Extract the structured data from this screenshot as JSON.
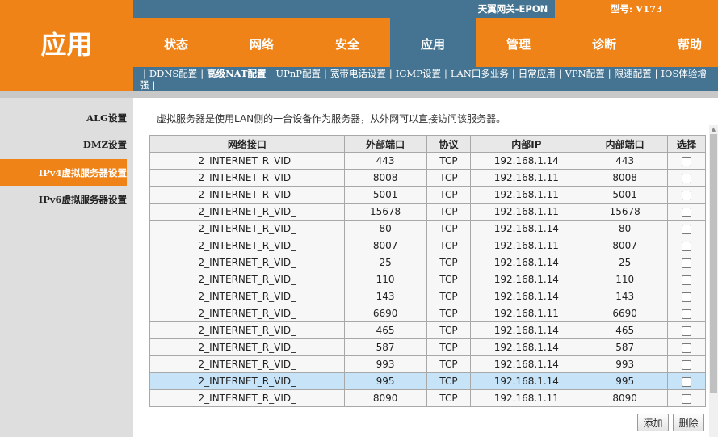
{
  "logo": {
    "text": "应用"
  },
  "header": {
    "gateway_name": "天翼网关-EPON",
    "model": "型号: V173"
  },
  "main_nav": [
    {
      "label": "状态",
      "active": false
    },
    {
      "label": "网络",
      "active": false
    },
    {
      "label": "安全",
      "active": false
    },
    {
      "label": "应用",
      "active": true
    },
    {
      "label": "管理",
      "active": false
    },
    {
      "label": "诊断",
      "active": false
    },
    {
      "label": "帮助",
      "active": false
    }
  ],
  "sub_nav": [
    {
      "label": "DDNS配置",
      "active": false
    },
    {
      "label": "高级NAT配置",
      "active": true
    },
    {
      "label": "UPnP配置",
      "active": false
    },
    {
      "label": "宽带电话设置",
      "active": false
    },
    {
      "label": "IGMP设置",
      "active": false
    },
    {
      "label": "LAN口多业务",
      "active": false
    },
    {
      "label": "日常应用",
      "active": false
    },
    {
      "label": "VPN配置",
      "active": false
    },
    {
      "label": "限速配置",
      "active": false
    },
    {
      "label": "IOS体验增强",
      "active": false
    }
  ],
  "left_menu": [
    {
      "label": "ALG设置",
      "active": false
    },
    {
      "label": "DMZ设置",
      "active": false
    },
    {
      "label": "IPv4虚拟服务器设置",
      "active": true
    },
    {
      "label": "IPv6虚拟服务器设置",
      "active": false
    }
  ],
  "description": "虚拟服务器是使用LAN侧的一台设备作为服务器，从外网可以直接访问该服务器。",
  "table": {
    "headers": [
      "网络接口",
      "外部端口",
      "协议",
      "内部IP",
      "内部端口",
      "选择"
    ],
    "rows": [
      [
        "2_INTERNET_R_VID_",
        "443",
        "TCP",
        "192.168.1.14",
        "443"
      ],
      [
        "2_INTERNET_R_VID_",
        "8008",
        "TCP",
        "192.168.1.11",
        "8008"
      ],
      [
        "2_INTERNET_R_VID_",
        "5001",
        "TCP",
        "192.168.1.11",
        "5001"
      ],
      [
        "2_INTERNET_R_VID_",
        "15678",
        "TCP",
        "192.168.1.11",
        "15678"
      ],
      [
        "2_INTERNET_R_VID_",
        "80",
        "TCP",
        "192.168.1.14",
        "80"
      ],
      [
        "2_INTERNET_R_VID_",
        "8007",
        "TCP",
        "192.168.1.11",
        "8007"
      ],
      [
        "2_INTERNET_R_VID_",
        "25",
        "TCP",
        "192.168.1.14",
        "25"
      ],
      [
        "2_INTERNET_R_VID_",
        "110",
        "TCP",
        "192.168.1.14",
        "110"
      ],
      [
        "2_INTERNET_R_VID_",
        "143",
        "TCP",
        "192.168.1.14",
        "143"
      ],
      [
        "2_INTERNET_R_VID_",
        "6690",
        "TCP",
        "192.168.1.11",
        "6690"
      ],
      [
        "2_INTERNET_R_VID_",
        "465",
        "TCP",
        "192.168.1.14",
        "465"
      ],
      [
        "2_INTERNET_R_VID_",
        "587",
        "TCP",
        "192.168.1.14",
        "587"
      ],
      [
        "2_INTERNET_R_VID_",
        "993",
        "TCP",
        "192.168.1.14",
        "993"
      ],
      [
        "2_INTERNET_R_VID_",
        "995",
        "TCP",
        "192.168.1.14",
        "995"
      ],
      [
        "2_INTERNET_R_VID_",
        "8090",
        "TCP",
        "192.168.1.11",
        "8090"
      ]
    ],
    "highlighted_row": 13
  },
  "buttons": {
    "add": "添加",
    "delete": "删除"
  },
  "colors": {
    "orange": "#ef8318",
    "blue": "#457492",
    "highlight": "#c7e3f8"
  }
}
